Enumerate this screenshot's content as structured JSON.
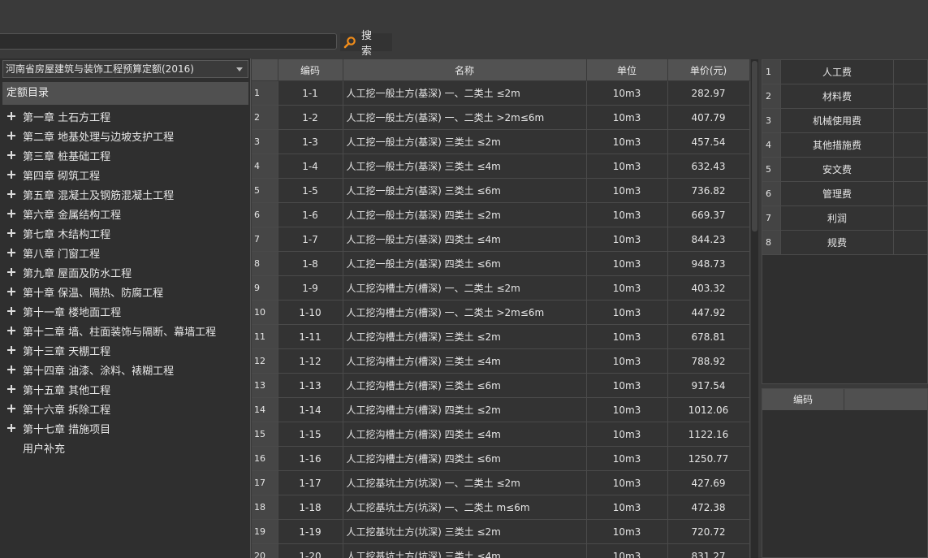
{
  "search": {
    "value": "",
    "button_label": "搜 索"
  },
  "left_panel": {
    "quota_select": "河南省房屋建筑与装饰工程预算定额(2016)",
    "catalog_header": "定额目录",
    "tree": [
      {
        "label": "第一章 土石方工程",
        "expandable": true
      },
      {
        "label": "第二章 地基处理与边坡支护工程",
        "expandable": true
      },
      {
        "label": "第三章 桩基础工程",
        "expandable": true
      },
      {
        "label": "第四章 砌筑工程",
        "expandable": true
      },
      {
        "label": "第五章 混凝土及钢筋混凝土工程",
        "expandable": true
      },
      {
        "label": "第六章 金属结构工程",
        "expandable": true
      },
      {
        "label": "第七章 木结构工程",
        "expandable": true
      },
      {
        "label": "第八章 门窗工程",
        "expandable": true
      },
      {
        "label": "第九章 屋面及防水工程",
        "expandable": true
      },
      {
        "label": "第十章 保温、隔热、防腐工程",
        "expandable": true
      },
      {
        "label": "第十一章 楼地面工程",
        "expandable": true
      },
      {
        "label": "第十二章 墙、柱面装饰与隔断、幕墙工程",
        "expandable": true
      },
      {
        "label": "第十三章 天棚工程",
        "expandable": true
      },
      {
        "label": "第十四章 油漆、涂料、裱糊工程",
        "expandable": true
      },
      {
        "label": "第十五章 其他工程",
        "expandable": true
      },
      {
        "label": "第十六章 拆除工程",
        "expandable": true
      },
      {
        "label": "第十七章 措施项目",
        "expandable": true
      },
      {
        "label": "用户补充",
        "expandable": false
      }
    ]
  },
  "grid": {
    "columns": [
      "",
      "编码",
      "名称",
      "单位",
      "单价(元)"
    ],
    "rows": [
      [
        "1",
        "1-1",
        "人工挖一般土方(基深) 一、二类土 ≤2m",
        "10m3",
        "282.97"
      ],
      [
        "2",
        "1-2",
        "人工挖一般土方(基深) 一、二类土 >2m≤6m",
        "10m3",
        "407.79"
      ],
      [
        "3",
        "1-3",
        "人工挖一般土方(基深) 三类土 ≤2m",
        "10m3",
        "457.54"
      ],
      [
        "4",
        "1-4",
        "人工挖一般土方(基深) 三类土 ≤4m",
        "10m3",
        "632.43"
      ],
      [
        "5",
        "1-5",
        "人工挖一般土方(基深) 三类土 ≤6m",
        "10m3",
        "736.82"
      ],
      [
        "6",
        "1-6",
        "人工挖一般土方(基深) 四类土 ≤2m",
        "10m3",
        "669.37"
      ],
      [
        "7",
        "1-7",
        "人工挖一般土方(基深) 四类土 ≤4m",
        "10m3",
        "844.23"
      ],
      [
        "8",
        "1-8",
        "人工挖一般土方(基深) 四类土 ≤6m",
        "10m3",
        "948.73"
      ],
      [
        "9",
        "1-9",
        "人工挖沟槽土方(槽深) 一、二类土 ≤2m",
        "10m3",
        "403.32"
      ],
      [
        "10",
        "1-10",
        "人工挖沟槽土方(槽深) 一、二类土 >2m≤6m",
        "10m3",
        "447.92"
      ],
      [
        "11",
        "1-11",
        "人工挖沟槽土方(槽深) 三类土 ≤2m",
        "10m3",
        "678.81"
      ],
      [
        "12",
        "1-12",
        "人工挖沟槽土方(槽深) 三类土 ≤4m",
        "10m3",
        "788.92"
      ],
      [
        "13",
        "1-13",
        "人工挖沟槽土方(槽深) 三类土 ≤6m",
        "10m3",
        "917.54"
      ],
      [
        "14",
        "1-14",
        "人工挖沟槽土方(槽深) 四类土 ≤2m",
        "10m3",
        "1012.06"
      ],
      [
        "15",
        "1-15",
        "人工挖沟槽土方(槽深) 四类土 ≤4m",
        "10m3",
        "1122.16"
      ],
      [
        "16",
        "1-16",
        "人工挖沟槽土方(槽深) 四类土 ≤6m",
        "10m3",
        "1250.77"
      ],
      [
        "17",
        "1-17",
        "人工挖基坑土方(坑深) 一、二类土 ≤2m",
        "10m3",
        "427.69"
      ],
      [
        "18",
        "1-18",
        "人工挖基坑土方(坑深) 一、二类土 m≤6m",
        "10m3",
        "472.38"
      ],
      [
        "19",
        "1-19",
        "人工挖基坑土方(坑深) 三类土 ≤2m",
        "10m3",
        "720.72"
      ],
      [
        "20",
        "1-20",
        "人工挖基坑土方(坑深) 三类土 ≤4m",
        "10m3",
        "831.27"
      ]
    ]
  },
  "fees": [
    {
      "index": "1",
      "name": "人工费"
    },
    {
      "index": "2",
      "name": "材料费"
    },
    {
      "index": "3",
      "name": "机械使用费"
    },
    {
      "index": "4",
      "name": "其他措施费"
    },
    {
      "index": "5",
      "name": "安文费"
    },
    {
      "index": "6",
      "name": "管理费"
    },
    {
      "index": "7",
      "name": "利润"
    },
    {
      "index": "8",
      "name": "规费"
    }
  ],
  "code_panel": {
    "header": "编码"
  },
  "colors": {
    "search_icon": "#f08c1a"
  }
}
